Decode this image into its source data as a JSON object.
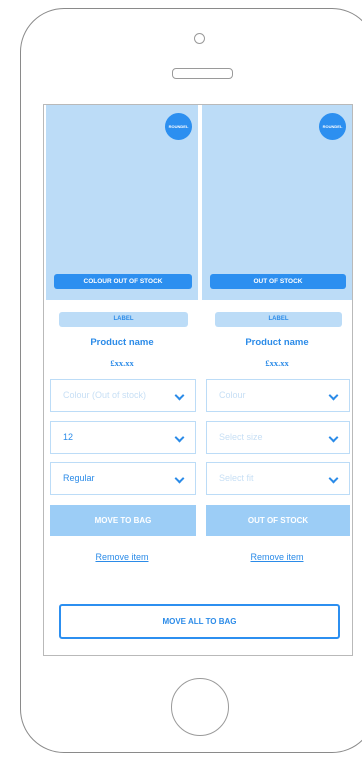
{
  "products": [
    {
      "badge": "ROUNDEL",
      "stock_banner": "COLOUR OUT OF STOCK",
      "label": "LABEL",
      "name": "Product name",
      "price": "£xx.xx",
      "colour": "Colour (Out of stock)",
      "size": "12",
      "fit": "Regular",
      "action": "MOVE TO BAG",
      "remove": "Remove item"
    },
    {
      "badge": "ROUNDEL",
      "stock_banner": "OUT OF STOCK",
      "label": "LABEL",
      "name": "Product name",
      "price": "£xx.xx",
      "colour": "Colour",
      "size": "Select size",
      "fit": "Select fit",
      "action": "OUT OF STOCK",
      "remove": "Remove item"
    }
  ],
  "move_all": "MOVE ALL TO BAG",
  "colors": {
    "accent": "#2c8ff0",
    "light": "#bcdcf7",
    "text": "#2b8be8"
  }
}
